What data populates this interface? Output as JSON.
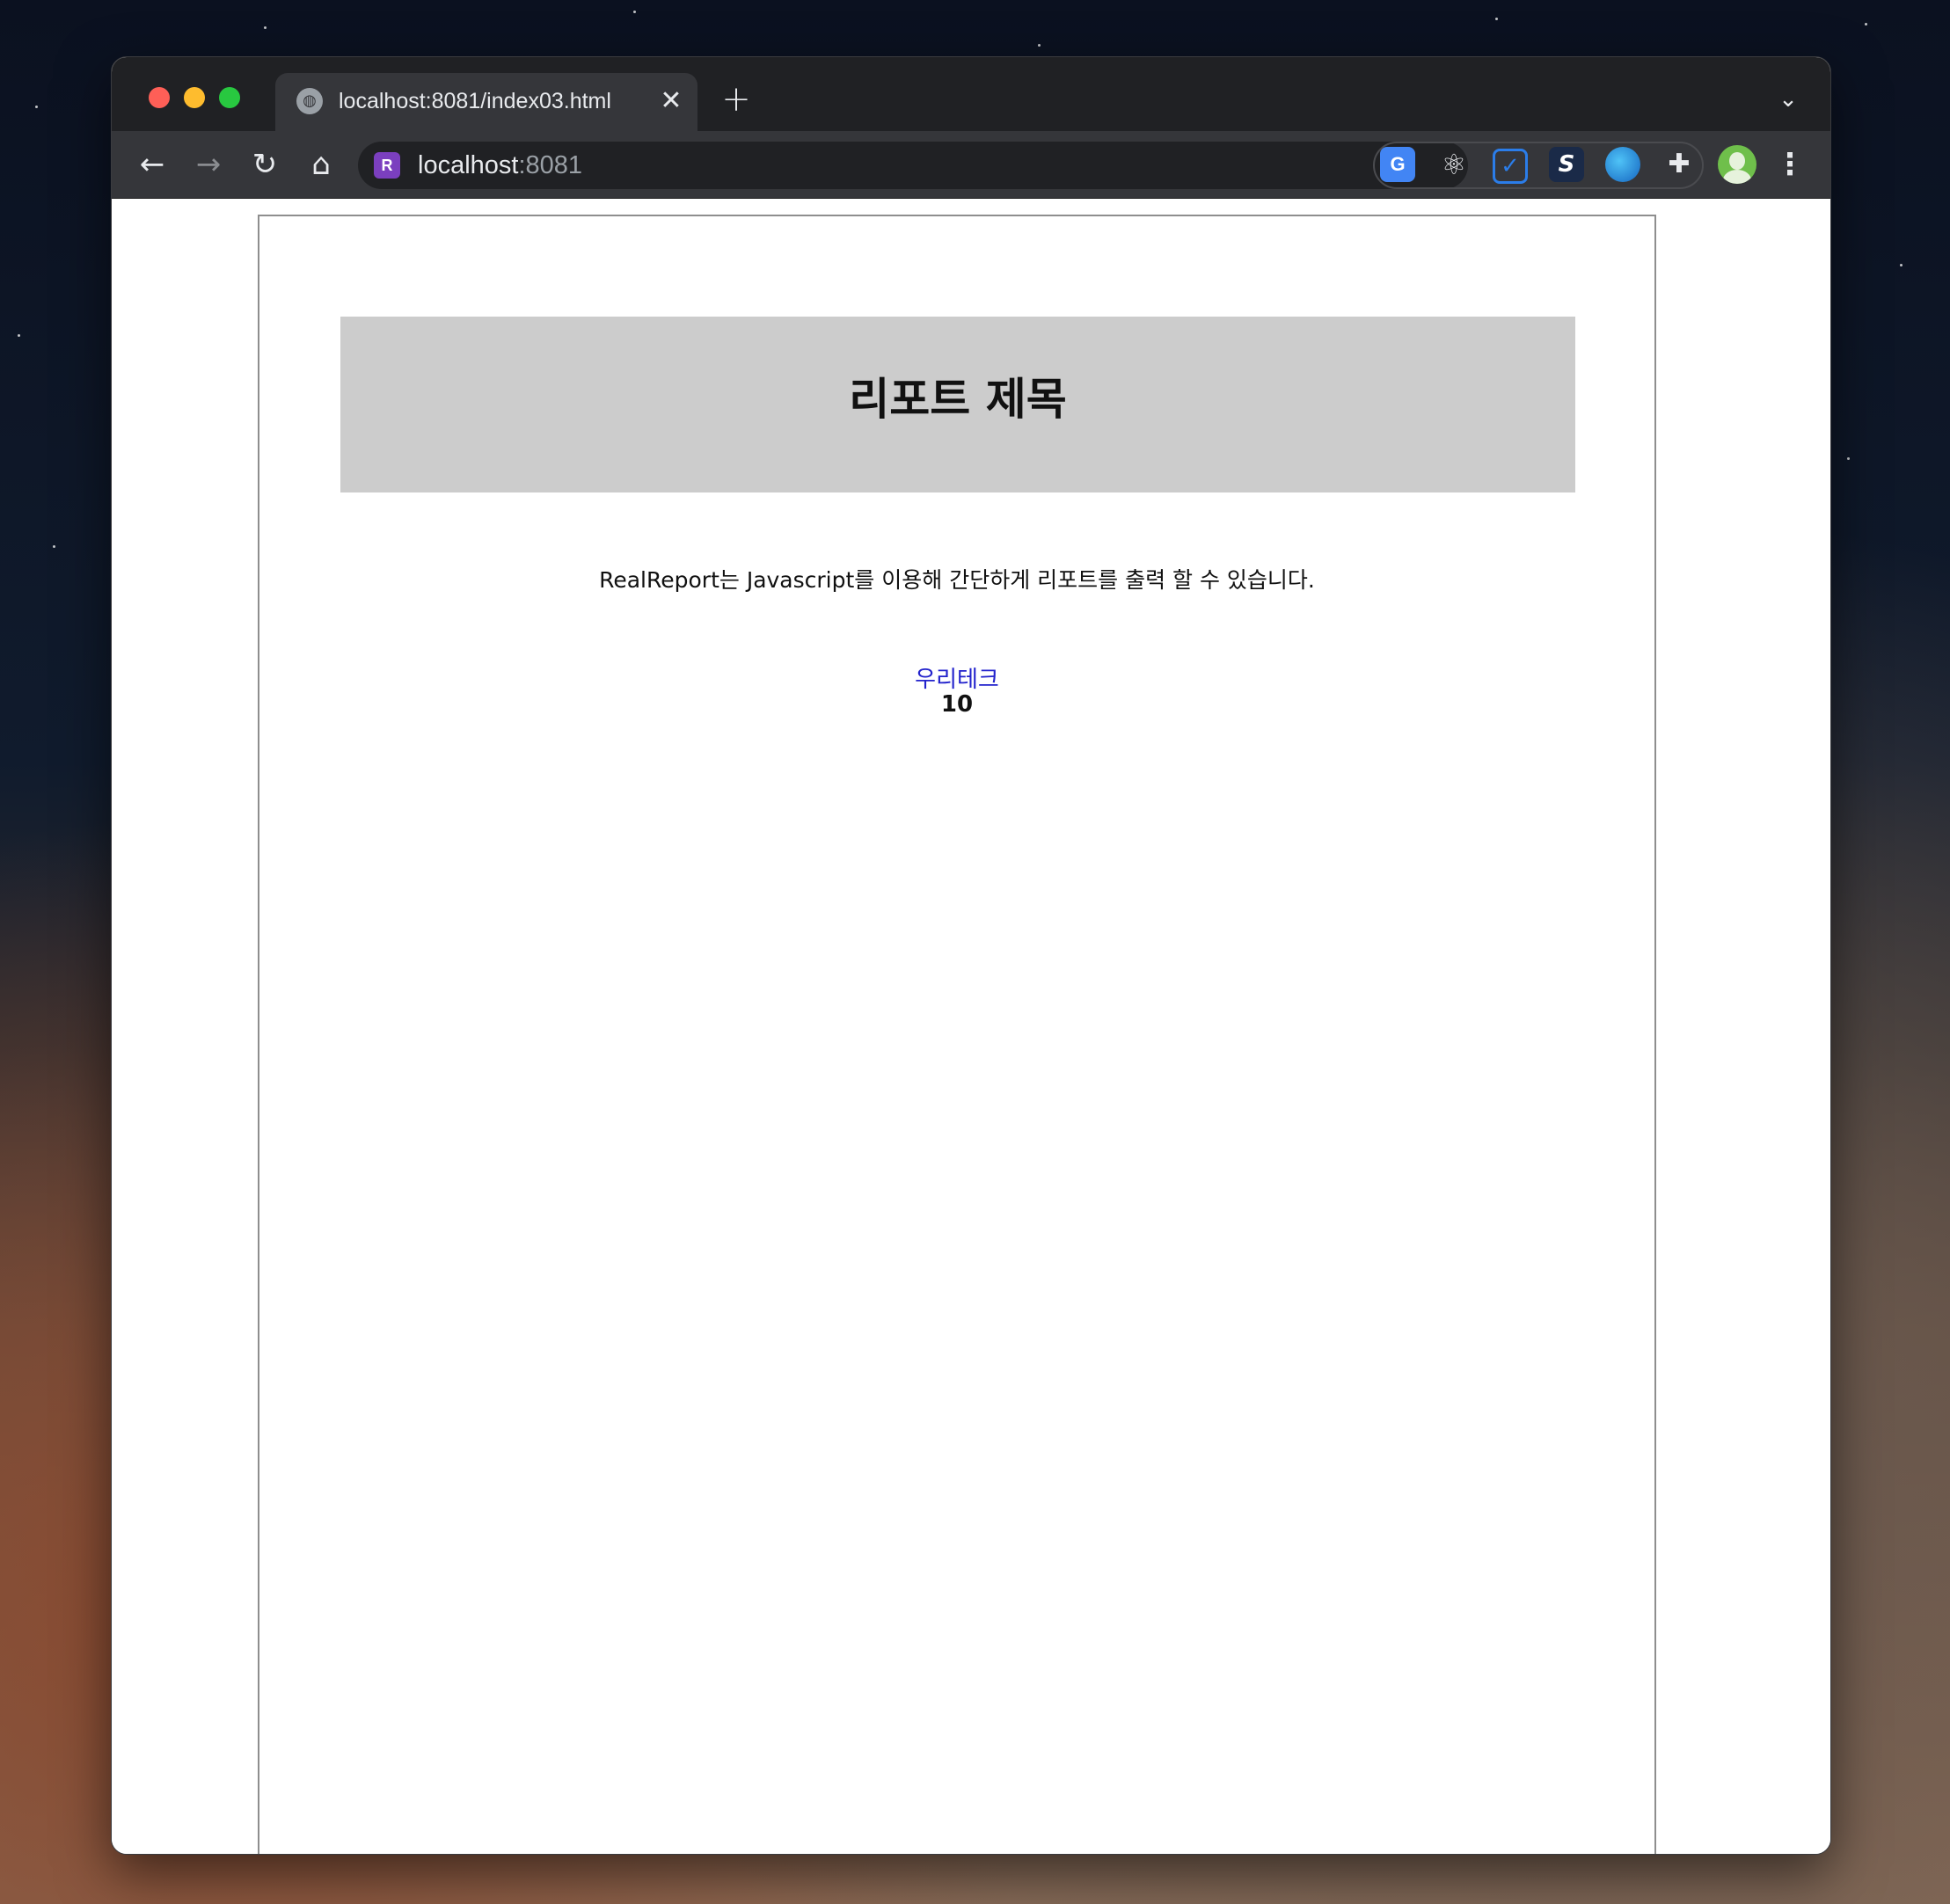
{
  "browser": {
    "tab": {
      "title": "localhost:8081/index03.html",
      "favicon_icon": "globe-icon",
      "close_glyph": "✕"
    },
    "new_tab_glyph": "+",
    "tab_dropdown_glyph": "⌄",
    "nav": {
      "back_glyph": "←",
      "forward_glyph": "→",
      "reload_glyph": "↻",
      "home_glyph": "⌂"
    },
    "address": {
      "site_badge": "R",
      "host": "localhost",
      "port": ":8081"
    },
    "extensions": [
      {
        "name": "google-translate-icon",
        "glyph": "G"
      },
      {
        "name": "react-devtools-icon",
        "glyph": "⚛"
      },
      {
        "name": "todo-check-icon",
        "glyph": "✓"
      },
      {
        "name": "stylus-icon",
        "glyph": "S"
      },
      {
        "name": "globe-extension-icon",
        "glyph": ""
      },
      {
        "name": "puzzle-icon",
        "glyph": "✚"
      }
    ],
    "menu_glyph": "⋮",
    "colors": {
      "chrome_dark": "#202124",
      "toolbar": "#35363a",
      "traffic_red": "#fe5f57",
      "traffic_yellow": "#febc2e",
      "traffic_green": "#28c840"
    }
  },
  "report": {
    "title": "리포트 제목",
    "description": "RealReport는 Javascript를 이용해 간단하게 리포트를 출력 할 수 있습니다.",
    "company": "우리테크",
    "value": "10",
    "colors": {
      "header_bg": "#cccccc",
      "company_text": "#2222cc"
    }
  }
}
